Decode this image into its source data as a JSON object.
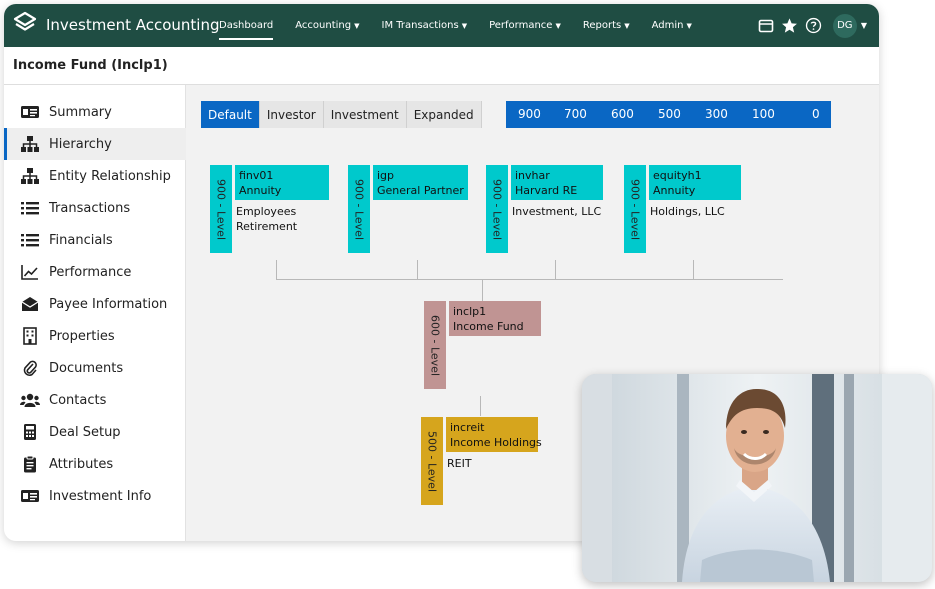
{
  "app": {
    "title": "Investment Accounting"
  },
  "nav": [
    {
      "label": "Dashboard",
      "dropdown": false
    },
    {
      "label": "Accounting",
      "dropdown": true
    },
    {
      "label": "IM Transactions",
      "dropdown": true
    },
    {
      "label": "Performance",
      "dropdown": true
    },
    {
      "label": "Reports",
      "dropdown": true
    },
    {
      "label": "Admin",
      "dropdown": true
    }
  ],
  "user": {
    "initials": "DG"
  },
  "page": {
    "title": "Income Fund (Inclp1)"
  },
  "sidebar": {
    "items": [
      {
        "label": "Summary",
        "icon": "id-card-icon"
      },
      {
        "label": "Hierarchy",
        "icon": "hierarchy-icon",
        "active": true
      },
      {
        "label": "Entity Relationship",
        "icon": "hierarchy-icon"
      },
      {
        "label": "Transactions",
        "icon": "list-icon"
      },
      {
        "label": "Financials",
        "icon": "list-icon"
      },
      {
        "label": "Performance",
        "icon": "line-chart-icon"
      },
      {
        "label": "Payee Information",
        "icon": "envelope-icon"
      },
      {
        "label": "Properties",
        "icon": "building-icon"
      },
      {
        "label": "Documents",
        "icon": "paperclip-icon"
      },
      {
        "label": "Contacts",
        "icon": "contacts-icon"
      },
      {
        "label": "Deal Setup",
        "icon": "calculator-icon"
      },
      {
        "label": "Attributes",
        "icon": "clipboard-icon"
      },
      {
        "label": "Investment Info",
        "icon": "id-card-icon"
      }
    ]
  },
  "tabs": [
    {
      "label": "Default",
      "active": true
    },
    {
      "label": "Investor"
    },
    {
      "label": "Investment"
    },
    {
      "label": "Expanded"
    }
  ],
  "levels": [
    "900",
    "700",
    "600",
    "500",
    "300",
    "100",
    "0"
  ],
  "nodes": {
    "finv01": {
      "level": "900 - Level",
      "code": "finv01",
      "type": "Annuity",
      "desc1": "Employees",
      "desc2": "Retirement"
    },
    "igp": {
      "level": "900 - Level",
      "code": "igp",
      "type": "General Partner",
      "desc1": "",
      "desc2": ""
    },
    "invhar": {
      "level": "900 - Level",
      "code": "invhar",
      "type": "Harvard RE",
      "desc1": "Investment, LLC",
      "desc2": ""
    },
    "equityh1": {
      "level": "900 - Level",
      "code": "equityh1",
      "type": "Annuity",
      "desc1": "Holdings, LLC",
      "desc2": ""
    },
    "inclp1": {
      "level": "600 - Level",
      "code": "inclp1",
      "type": "Income Fund",
      "desc1": "",
      "desc2": ""
    },
    "increit": {
      "level": "500 - Level",
      "code": "increit",
      "type": "Income Holdings",
      "desc1": "REIT",
      "desc2": ""
    }
  },
  "colors": {
    "header": "#1f4d43",
    "accent": "#0a67c4",
    "level900": "#00c9cc",
    "level600": "#c09493",
    "level500": "#d6a51d"
  }
}
